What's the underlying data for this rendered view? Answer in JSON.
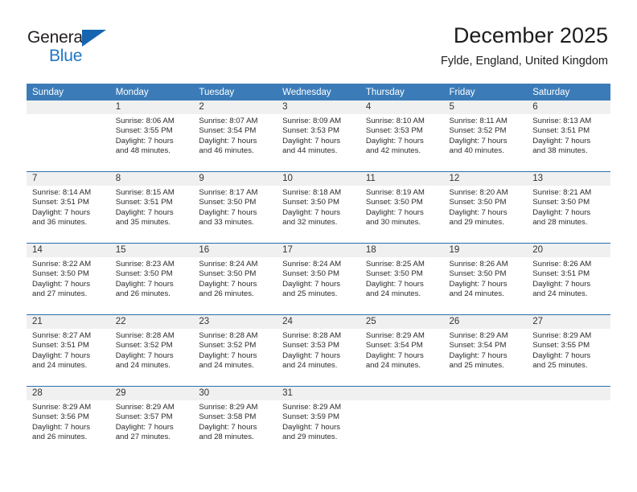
{
  "branding": {
    "name_part1": "General",
    "name_part2": "Blue",
    "logo_color_dark": "#231f20",
    "logo_color_blue": "#1f76c4"
  },
  "header": {
    "month_title": "December 2025",
    "location": "Fylde, England, United Kingdom"
  },
  "theme": {
    "header_bg": "#3b7cb8",
    "row_divider": "#2b6eae",
    "daynum_band_bg": "#f0f0f0"
  },
  "weekday_headers": [
    "Sunday",
    "Monday",
    "Tuesday",
    "Wednesday",
    "Thursday",
    "Friday",
    "Saturday"
  ],
  "weeks": [
    [
      {
        "day": "",
        "sunrise": "",
        "sunset": "",
        "daylight_line1": "",
        "daylight_line2": "",
        "empty": true
      },
      {
        "day": "1",
        "sunrise": "Sunrise: 8:06 AM",
        "sunset": "Sunset: 3:55 PM",
        "daylight_line1": "Daylight: 7 hours",
        "daylight_line2": "and 48 minutes."
      },
      {
        "day": "2",
        "sunrise": "Sunrise: 8:07 AM",
        "sunset": "Sunset: 3:54 PM",
        "daylight_line1": "Daylight: 7 hours",
        "daylight_line2": "and 46 minutes."
      },
      {
        "day": "3",
        "sunrise": "Sunrise: 8:09 AM",
        "sunset": "Sunset: 3:53 PM",
        "daylight_line1": "Daylight: 7 hours",
        "daylight_line2": "and 44 minutes."
      },
      {
        "day": "4",
        "sunrise": "Sunrise: 8:10 AM",
        "sunset": "Sunset: 3:53 PM",
        "daylight_line1": "Daylight: 7 hours",
        "daylight_line2": "and 42 minutes."
      },
      {
        "day": "5",
        "sunrise": "Sunrise: 8:11 AM",
        "sunset": "Sunset: 3:52 PM",
        "daylight_line1": "Daylight: 7 hours",
        "daylight_line2": "and 40 minutes."
      },
      {
        "day": "6",
        "sunrise": "Sunrise: 8:13 AM",
        "sunset": "Sunset: 3:51 PM",
        "daylight_line1": "Daylight: 7 hours",
        "daylight_line2": "and 38 minutes."
      }
    ],
    [
      {
        "day": "7",
        "sunrise": "Sunrise: 8:14 AM",
        "sunset": "Sunset: 3:51 PM",
        "daylight_line1": "Daylight: 7 hours",
        "daylight_line2": "and 36 minutes."
      },
      {
        "day": "8",
        "sunrise": "Sunrise: 8:15 AM",
        "sunset": "Sunset: 3:51 PM",
        "daylight_line1": "Daylight: 7 hours",
        "daylight_line2": "and 35 minutes."
      },
      {
        "day": "9",
        "sunrise": "Sunrise: 8:17 AM",
        "sunset": "Sunset: 3:50 PM",
        "daylight_line1": "Daylight: 7 hours",
        "daylight_line2": "and 33 minutes."
      },
      {
        "day": "10",
        "sunrise": "Sunrise: 8:18 AM",
        "sunset": "Sunset: 3:50 PM",
        "daylight_line1": "Daylight: 7 hours",
        "daylight_line2": "and 32 minutes."
      },
      {
        "day": "11",
        "sunrise": "Sunrise: 8:19 AM",
        "sunset": "Sunset: 3:50 PM",
        "daylight_line1": "Daylight: 7 hours",
        "daylight_line2": "and 30 minutes."
      },
      {
        "day": "12",
        "sunrise": "Sunrise: 8:20 AM",
        "sunset": "Sunset: 3:50 PM",
        "daylight_line1": "Daylight: 7 hours",
        "daylight_line2": "and 29 minutes."
      },
      {
        "day": "13",
        "sunrise": "Sunrise: 8:21 AM",
        "sunset": "Sunset: 3:50 PM",
        "daylight_line1": "Daylight: 7 hours",
        "daylight_line2": "and 28 minutes."
      }
    ],
    [
      {
        "day": "14",
        "sunrise": "Sunrise: 8:22 AM",
        "sunset": "Sunset: 3:50 PM",
        "daylight_line1": "Daylight: 7 hours",
        "daylight_line2": "and 27 minutes."
      },
      {
        "day": "15",
        "sunrise": "Sunrise: 8:23 AM",
        "sunset": "Sunset: 3:50 PM",
        "daylight_line1": "Daylight: 7 hours",
        "daylight_line2": "and 26 minutes."
      },
      {
        "day": "16",
        "sunrise": "Sunrise: 8:24 AM",
        "sunset": "Sunset: 3:50 PM",
        "daylight_line1": "Daylight: 7 hours",
        "daylight_line2": "and 26 minutes."
      },
      {
        "day": "17",
        "sunrise": "Sunrise: 8:24 AM",
        "sunset": "Sunset: 3:50 PM",
        "daylight_line1": "Daylight: 7 hours",
        "daylight_line2": "and 25 minutes."
      },
      {
        "day": "18",
        "sunrise": "Sunrise: 8:25 AM",
        "sunset": "Sunset: 3:50 PM",
        "daylight_line1": "Daylight: 7 hours",
        "daylight_line2": "and 24 minutes."
      },
      {
        "day": "19",
        "sunrise": "Sunrise: 8:26 AM",
        "sunset": "Sunset: 3:50 PM",
        "daylight_line1": "Daylight: 7 hours",
        "daylight_line2": "and 24 minutes."
      },
      {
        "day": "20",
        "sunrise": "Sunrise: 8:26 AM",
        "sunset": "Sunset: 3:51 PM",
        "daylight_line1": "Daylight: 7 hours",
        "daylight_line2": "and 24 minutes."
      }
    ],
    [
      {
        "day": "21",
        "sunrise": "Sunrise: 8:27 AM",
        "sunset": "Sunset: 3:51 PM",
        "daylight_line1": "Daylight: 7 hours",
        "daylight_line2": "and 24 minutes."
      },
      {
        "day": "22",
        "sunrise": "Sunrise: 8:28 AM",
        "sunset": "Sunset: 3:52 PM",
        "daylight_line1": "Daylight: 7 hours",
        "daylight_line2": "and 24 minutes."
      },
      {
        "day": "23",
        "sunrise": "Sunrise: 8:28 AM",
        "sunset": "Sunset: 3:52 PM",
        "daylight_line1": "Daylight: 7 hours",
        "daylight_line2": "and 24 minutes."
      },
      {
        "day": "24",
        "sunrise": "Sunrise: 8:28 AM",
        "sunset": "Sunset: 3:53 PM",
        "daylight_line1": "Daylight: 7 hours",
        "daylight_line2": "and 24 minutes."
      },
      {
        "day": "25",
        "sunrise": "Sunrise: 8:29 AM",
        "sunset": "Sunset: 3:54 PM",
        "daylight_line1": "Daylight: 7 hours",
        "daylight_line2": "and 24 minutes."
      },
      {
        "day": "26",
        "sunrise": "Sunrise: 8:29 AM",
        "sunset": "Sunset: 3:54 PM",
        "daylight_line1": "Daylight: 7 hours",
        "daylight_line2": "and 25 minutes."
      },
      {
        "day": "27",
        "sunrise": "Sunrise: 8:29 AM",
        "sunset": "Sunset: 3:55 PM",
        "daylight_line1": "Daylight: 7 hours",
        "daylight_line2": "and 25 minutes."
      }
    ],
    [
      {
        "day": "28",
        "sunrise": "Sunrise: 8:29 AM",
        "sunset": "Sunset: 3:56 PM",
        "daylight_line1": "Daylight: 7 hours",
        "daylight_line2": "and 26 minutes."
      },
      {
        "day": "29",
        "sunrise": "Sunrise: 8:29 AM",
        "sunset": "Sunset: 3:57 PM",
        "daylight_line1": "Daylight: 7 hours",
        "daylight_line2": "and 27 minutes."
      },
      {
        "day": "30",
        "sunrise": "Sunrise: 8:29 AM",
        "sunset": "Sunset: 3:58 PM",
        "daylight_line1": "Daylight: 7 hours",
        "daylight_line2": "and 28 minutes."
      },
      {
        "day": "31",
        "sunrise": "Sunrise: 8:29 AM",
        "sunset": "Sunset: 3:59 PM",
        "daylight_line1": "Daylight: 7 hours",
        "daylight_line2": "and 29 minutes."
      },
      {
        "day": "",
        "sunrise": "",
        "sunset": "",
        "daylight_line1": "",
        "daylight_line2": "",
        "empty": true
      },
      {
        "day": "",
        "sunrise": "",
        "sunset": "",
        "daylight_line1": "",
        "daylight_line2": "",
        "empty": true
      },
      {
        "day": "",
        "sunrise": "",
        "sunset": "",
        "daylight_line1": "",
        "daylight_line2": "",
        "empty": true
      }
    ]
  ]
}
